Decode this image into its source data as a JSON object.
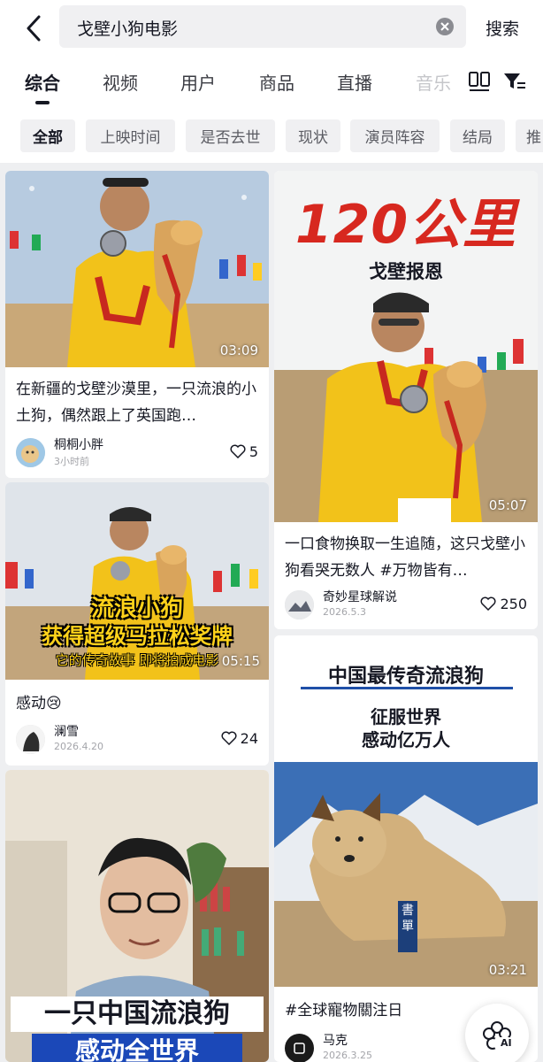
{
  "search": {
    "query": "戈壁小狗电影",
    "button_label": "搜索"
  },
  "tabs": [
    "综合",
    "视频",
    "用户",
    "商品",
    "直播",
    "音乐"
  ],
  "filters": [
    "全部",
    "上映时间",
    "是否去世",
    "现状",
    "演员阵容",
    "结局",
    "推"
  ],
  "cards": [
    {
      "title": "在新疆的戈壁沙漠里，一只流浪的小土狗，偶然跟上了英国跑…",
      "duration": "03:09",
      "author": "桐桐小胖",
      "date": "3小时前",
      "likes": "5"
    },
    {
      "title": "一口食物换取一生追随，这只戈壁小狗看哭无数人 #万物皆有…",
      "duration": "05:07",
      "author": "奇妙星球解说",
      "date": "2026.5.3",
      "likes": "250",
      "overlay_line1": "120公里",
      "overlay_line2": "戈壁报恩"
    },
    {
      "title": "感动😢",
      "duration": "05:15",
      "author": "澜雪",
      "date": "2026.4.20",
      "likes": "24",
      "overlay_line1": "流浪小狗",
      "overlay_line2": "获得超级马拉松奖牌",
      "overlay_line3": "它的传奇故事 即将拍成电影"
    },
    {
      "title": "#全球寵物關注日",
      "duration": "03:21",
      "author": "马克",
      "date": "2026.3.25",
      "overlay_line1": "中国最传奇流浪狗",
      "overlay_line2": "征服世界",
      "overlay_line3": "感动亿万人",
      "stamp": "書單"
    },
    {
      "overlay_line1": "一只中国流浪狗",
      "overlay_line2": "感动全世界"
    }
  ],
  "ai_button": "AI",
  "colors": {
    "accent_red": "#d7281f",
    "overlay_yellow": "#ffd21a",
    "bg": "#eeeff1"
  }
}
